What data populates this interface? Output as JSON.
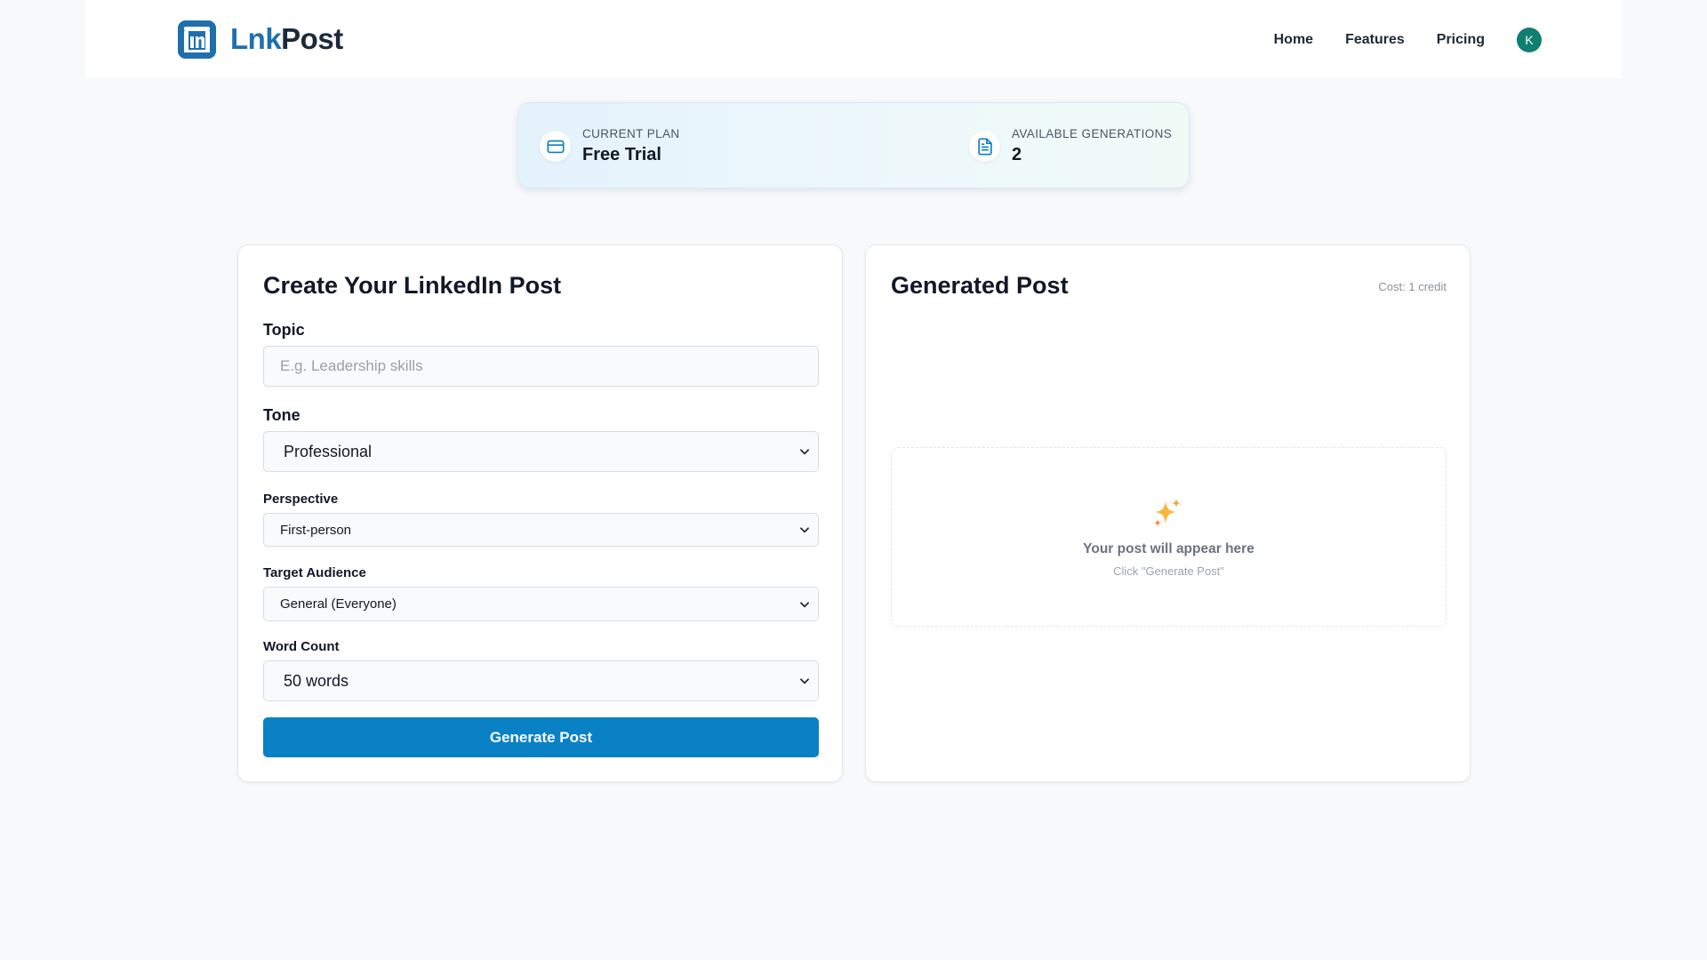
{
  "brand": {
    "name_part1": "Lnk",
    "name_part2": "Post",
    "logo_letter": "in"
  },
  "nav": {
    "items": [
      "Home",
      "Features",
      "Pricing"
    ],
    "avatar_initial": "K"
  },
  "plan": {
    "current_label": "CURRENT PLAN",
    "current_value": "Free Trial",
    "generations_label": "AVAILABLE GENERATIONS",
    "generations_value": "2"
  },
  "form": {
    "title": "Create Your LinkedIn Post",
    "topic": {
      "label": "Topic",
      "placeholder": "E.g. Leadership skills",
      "value": ""
    },
    "tone": {
      "label": "Tone",
      "value": "Professional"
    },
    "perspective": {
      "label": "Perspective",
      "value": "First-person"
    },
    "audience": {
      "label": "Target Audience",
      "value": "General (Everyone)"
    },
    "word_count": {
      "label": "Word Count",
      "value": "50 words"
    },
    "submit_label": "Generate Post"
  },
  "output": {
    "title": "Generated Post",
    "cost": "Cost: 1 credit",
    "placeholder_title": "Your post will appear here",
    "placeholder_sub": "Click \"Generate Post\""
  },
  "colors": {
    "primary": "#0a81c4",
    "brand_blue": "#1f6fae",
    "avatar": "#0f7f71",
    "background": "#f8f9fb"
  },
  "icons": {
    "plan": "credit-card-icon",
    "generations": "document-icon",
    "placeholder": "sparkles-icon",
    "select": "chevron-down-icon"
  }
}
